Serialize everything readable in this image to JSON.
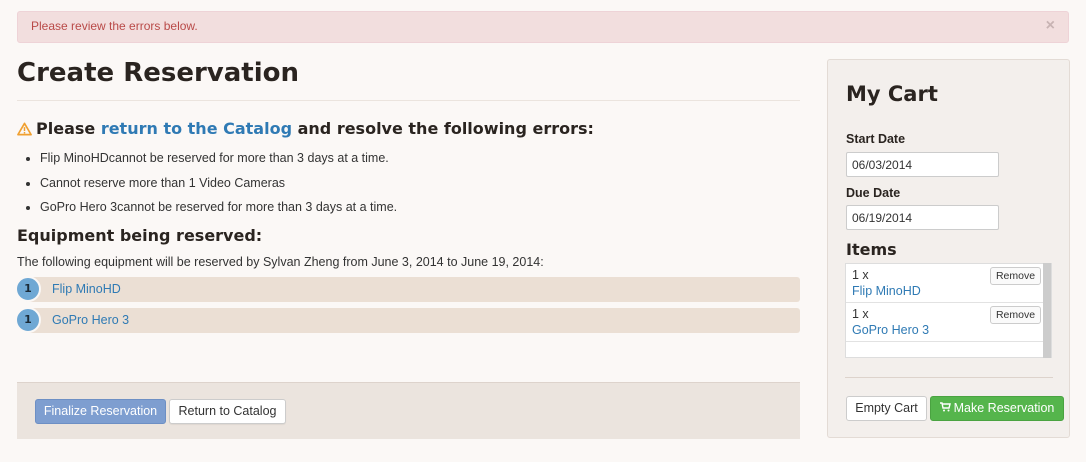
{
  "alert": {
    "message": "Please review the errors below.",
    "close_glyph": "×"
  },
  "page": {
    "title": "Create Reservation"
  },
  "errors": {
    "icon": "warning-icon",
    "prefix": "Please ",
    "link_text": "return to the Catalog",
    "suffix": " and resolve the following errors:",
    "items": [
      "Flip MinoHDcannot be reserved for more than 3 days at a time.",
      "Cannot reserve more than 1 Video Cameras",
      "GoPro Hero 3cannot be reserved for more than 3 days at a time."
    ]
  },
  "equipment": {
    "heading": "Equipment being reserved:",
    "description": "The following equipment will be reserved by Sylvan Zheng from June 3, 2014 to June 19, 2014:",
    "items": [
      {
        "count": "1",
        "name": "Flip MinoHD"
      },
      {
        "count": "1",
        "name": "GoPro Hero 3"
      }
    ]
  },
  "actions": {
    "finalize_label": "Finalize Reservation",
    "return_label": "Return to Catalog"
  },
  "cart": {
    "title": "My Cart",
    "start_label": "Start Date",
    "start_value": "06/03/2014",
    "due_label": "Due Date",
    "due_value": "06/19/2014",
    "items_title": "Items",
    "items": [
      {
        "qty": "1 x",
        "name": "Flip MinoHD",
        "remove_label": "Remove"
      },
      {
        "qty": "1 x",
        "name": "GoPro Hero 3",
        "remove_label": "Remove"
      }
    ],
    "empty_label": "Empty Cart",
    "make_label": "Make Reservation",
    "make_icon": "shopping-cart-icon"
  },
  "colors": {
    "alert_text": "#b94a48",
    "link": "#2f7ab4",
    "success": "#55b54c",
    "primary_muted": "#7e9ed0",
    "badge": "#6fa8d4"
  }
}
